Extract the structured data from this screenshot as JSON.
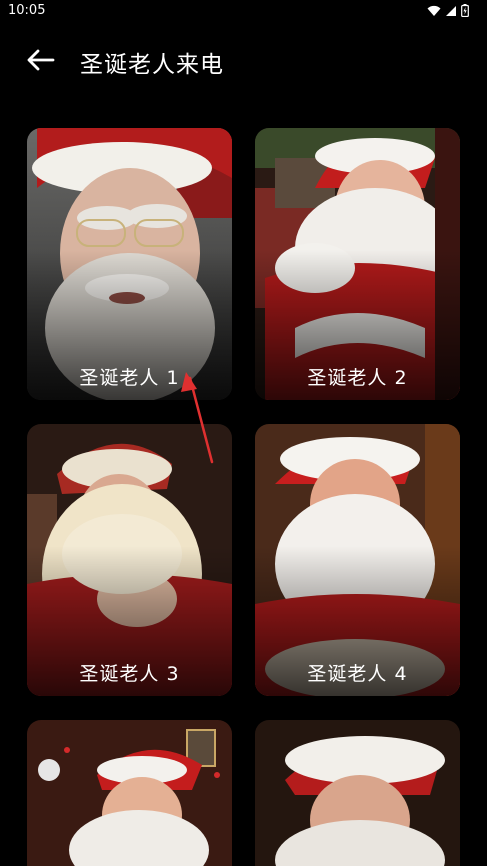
{
  "status_bar": {
    "time": "10:05"
  },
  "header": {
    "title": "圣诞老人来电"
  },
  "cards": [
    {
      "label": "圣诞老人 1"
    },
    {
      "label": "圣诞老人 2"
    },
    {
      "label": "圣诞老人 3"
    },
    {
      "label": "圣诞老人 4"
    },
    {
      "label": ""
    },
    {
      "label": ""
    }
  ],
  "colors": {
    "background": "#000000",
    "text": "#ffffff",
    "annotation_arrow": "#e03030"
  }
}
